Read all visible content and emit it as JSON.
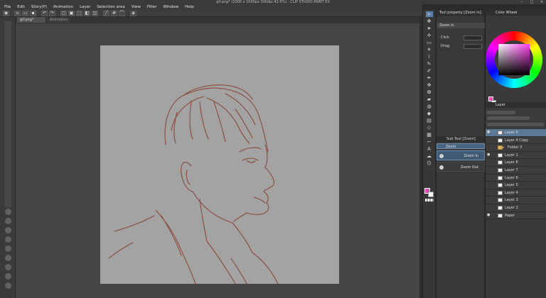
{
  "window": {
    "title": "gif.png* (1000 x 1000px 300dpi 42.5%) - CLIP STUDIO PAINT EX",
    "controls": [
      "–",
      "□",
      "✕"
    ]
  },
  "menu": [
    "File",
    "Edit",
    "Story(P)",
    "Animation",
    "Layer",
    "Selection area",
    "View",
    "Filter",
    "Window",
    "Help"
  ],
  "document_tabs": [
    {
      "label": "gif.png*"
    },
    {
      "label": "Animation"
    }
  ],
  "tool_property": {
    "header": "Tool property [Zoom in]",
    "selected": "Zoom in",
    "rows": [
      {
        "label": "Click"
      },
      {
        "label": "Drag"
      }
    ]
  },
  "sub_tool": {
    "header": "Sub Tool [Zoom]",
    "group": "Zoom",
    "items": [
      {
        "label": "Zoom in",
        "selected": true
      },
      {
        "label": "Zoom Out",
        "selected": false
      }
    ]
  },
  "color_wheel": {
    "header": "Color Wheel",
    "current_color": "#e14db5",
    "secondary_color": "#ffffff"
  },
  "layers": {
    "header": "Layer",
    "items": [
      {
        "name": "Layer 6",
        "selected": true,
        "type": "raster"
      },
      {
        "name": "Layer 4 Copy",
        "selected": false,
        "type": "raster"
      },
      {
        "name": "Folder 3",
        "selected": false,
        "type": "folder"
      },
      {
        "name": "Layer 1",
        "selected": false,
        "type": "raster"
      },
      {
        "name": "Layer 8",
        "selected": false,
        "type": "raster"
      },
      {
        "name": "Layer 7",
        "selected": false,
        "type": "raster"
      },
      {
        "name": "Layer 6",
        "selected": false,
        "type": "raster"
      },
      {
        "name": "Layer 5",
        "selected": false,
        "type": "raster"
      },
      {
        "name": "Layer 4",
        "selected": false,
        "type": "raster"
      },
      {
        "name": "Layer 3",
        "selected": false,
        "type": "raster"
      },
      {
        "name": "Layer 2",
        "selected": false,
        "type": "raster"
      },
      {
        "name": "Paper",
        "selected": false,
        "type": "paper"
      }
    ]
  },
  "canvas": {
    "paper_color": "#a3a3a3",
    "stroke_color": "#8a4a3a"
  }
}
